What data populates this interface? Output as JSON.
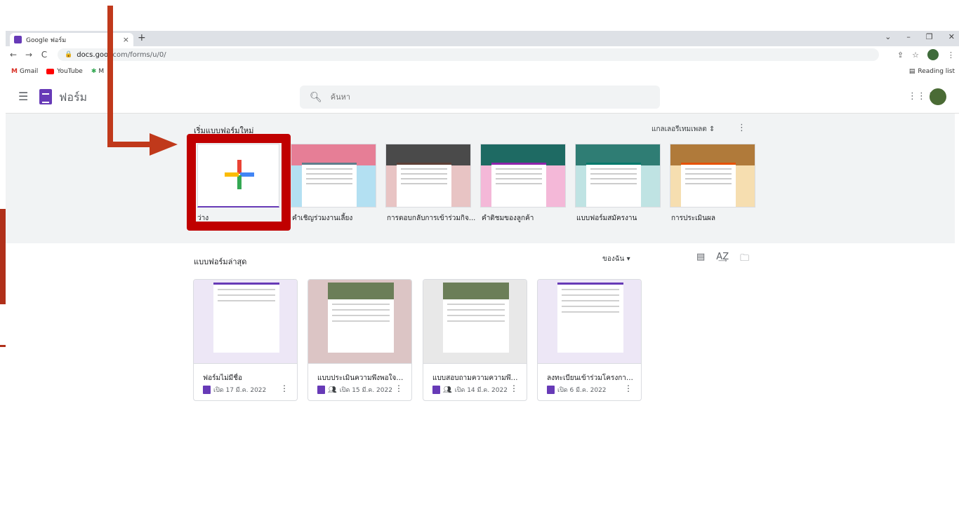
{
  "browser": {
    "tab_title": "Google ฟอร์ม",
    "url_host": "docs.goog",
    "url_path": "com/forms/u/0/",
    "bookmarks": [
      "Gmail",
      "YouTube",
      "M"
    ],
    "reading_list": "Reading list"
  },
  "app": {
    "title": "ฟอร์ม",
    "search_placeholder": "ค้นหา"
  },
  "gallery": {
    "title": "เริ่มแบบฟอร์มใหม่",
    "toggle": "แกลเลอรีเทมเพลต",
    "blank_label": "ว่าง",
    "templates": [
      {
        "label": "คำเชิญร่วมงานเลี้ยง",
        "color": "#b3e0f2"
      },
      {
        "label": "การตอบกลับการเข้าร่วมกิจ...",
        "color": "#e8c4c4"
      },
      {
        "label": "คำติชมของลูกค้า",
        "color": "#f4b8d8"
      },
      {
        "label": "แบบฟอร์มสมัครงาน",
        "color": "#bfe3e3"
      },
      {
        "label": "การประเมินผล",
        "color": "#f6deb0"
      }
    ]
  },
  "recent": {
    "title": "แบบฟอร์มล่าสุด",
    "owner_filter": "ของฉัน",
    "docs": [
      {
        "name": "ฟอร์มไม่มีชื่อ",
        "meta": "เปิด 17 มี.ค. 2022",
        "shared": false,
        "bg": "#ede7f6"
      },
      {
        "name": "แบบประเมินความพึงพอใจของ...",
        "meta": "เปิด 15 มี.ค. 2022",
        "shared": true,
        "bg": "#dcc5c5"
      },
      {
        "name": "แบบสอบถามความความพึงพอ...",
        "meta": "เปิด 14 มี.ค. 2022",
        "shared": true,
        "bg": "#e8e8e8"
      },
      {
        "name": "ลงทะเบียนเข้าร่วมโครงการอบ...",
        "meta": "เปิด 6 มี.ค. 2022",
        "shared": false,
        "bg": "#ede7f6"
      }
    ]
  },
  "colors": {
    "forms_purple": "#673ab7",
    "highlight_red": "#c00000",
    "arrow_red": "#c0391b"
  }
}
